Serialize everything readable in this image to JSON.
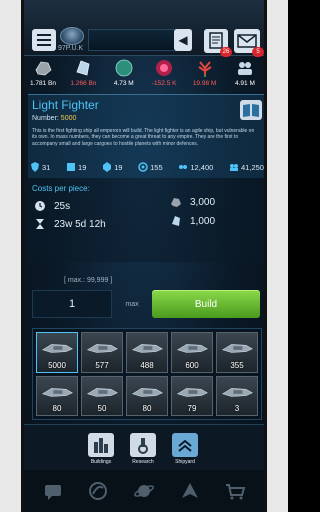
{
  "header": {
    "rank": "97P.U.K",
    "notes_badge": "26",
    "mail_badge": "5"
  },
  "resources": [
    {
      "name": "metal-icon",
      "value": "1.781 Bn",
      "color": "#ffffff"
    },
    {
      "name": "crystal-icon",
      "value": "1.266 Bn",
      "color": "#ff5a5a"
    },
    {
      "name": "deuterium-icon",
      "value": "4.73 M",
      "color": "#ffffff"
    },
    {
      "name": "energy-icon",
      "value": "-152.5 K",
      "color": "#ff5a5a"
    },
    {
      "name": "food-icon",
      "value": "19.98 M",
      "color": "#ff5a5a"
    },
    {
      "name": "population-icon",
      "value": "4.91 M",
      "color": "#ffffff"
    }
  ],
  "ship": {
    "title": "Light Fighter",
    "number_label": "Number:",
    "number_value": "5000",
    "description": "This is the first fighting ship all emperors will build. The light fighter is an agile ship, but vulnerable on its own. In mass numbers, they can become a great threat to any empire. They are the first to accompany small and large cargoes to hostile planets with minor defences."
  },
  "stats": [
    {
      "icon": "shield-icon",
      "value": "31"
    },
    {
      "icon": "weapon-icon",
      "value": "19"
    },
    {
      "icon": "armor-icon",
      "value": "19"
    },
    {
      "icon": "speed-icon",
      "value": "155"
    },
    {
      "icon": "fuel-icon",
      "value": "12,400"
    },
    {
      "icon": "cargo-icon",
      "value": "41,250"
    }
  ],
  "costs": {
    "title": "Costs per piece:",
    "time": "25s",
    "total_time": "23w 5d 12h",
    "metal": "3,000",
    "crystal": "1,000"
  },
  "build": {
    "max_label": "[ max.: 99,999 ]",
    "quantity": "1",
    "max_button": "max",
    "build_button": "Build"
  },
  "ships": [
    {
      "name": "light-fighter",
      "count": "5000",
      "selected": true
    },
    {
      "name": "heavy-fighter",
      "count": "577"
    },
    {
      "name": "cruiser",
      "count": "488"
    },
    {
      "name": "battleship",
      "count": "600"
    },
    {
      "name": "battlecruiser",
      "count": "355"
    },
    {
      "name": "bomber",
      "count": "80"
    },
    {
      "name": "destroyer",
      "count": "50"
    },
    {
      "name": "deathstar",
      "count": "80"
    },
    {
      "name": "small-cargo",
      "count": "79"
    },
    {
      "name": "large-cargo",
      "count": "3"
    }
  ],
  "subnav": [
    {
      "label": "Buildings",
      "icon": "buildings-icon"
    },
    {
      "label": "Research",
      "icon": "research-icon"
    },
    {
      "label": "Shipyard",
      "icon": "shipyard-icon"
    }
  ],
  "bottomnav": [
    "chat-icon",
    "alliance-icon",
    "galaxy-icon",
    "fleet-icon",
    "shop-icon"
  ],
  "colors": {
    "accent": "#4fc3f7",
    "build": "#6cc23a",
    "negative": "#ff5a5a",
    "number": "#f2c94c"
  }
}
